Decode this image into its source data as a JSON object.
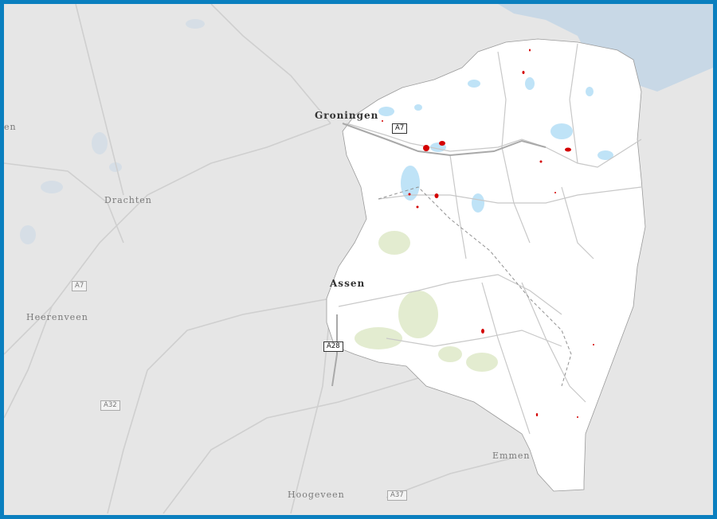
{
  "map": {
    "colors": {
      "frame": "#0a7fbf",
      "basemap": "#e6e6e6",
      "region": "#ffffff",
      "water": "#bfe3f7",
      "sea": "#c8d8e6",
      "roads": "#c8c8c8",
      "boundary": "#999999",
      "hotspot": "#d40000"
    },
    "cities": {
      "groningen": "Groningen",
      "drachten": "Drachten",
      "assen": "Assen",
      "heerenveen": "Heerenveen",
      "emmen": "Emmen",
      "hoogeveen": "Hoogeveen",
      "edge": "en"
    },
    "roads": {
      "a7_east": "A7",
      "a7_west": "A7",
      "a28": "A28",
      "a32": "A32",
      "a37": "A37"
    }
  }
}
